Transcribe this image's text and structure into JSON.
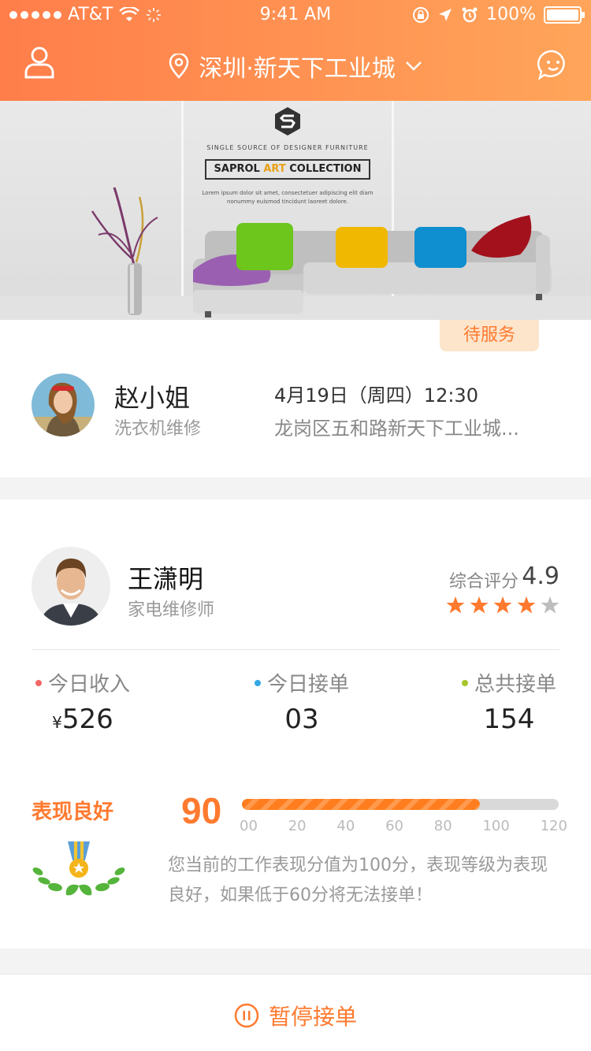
{
  "status_bar": {
    "carrier": "AT&T",
    "time": "9:41 AM",
    "battery": "100%"
  },
  "header": {
    "location": "深圳·新天下工业城",
    "icons": [
      "user-icon",
      "location-pin-icon",
      "chevron-down-icon",
      "chat-icon"
    ]
  },
  "banner": {
    "tagline": "SINGLE SOURCE OF DESIGNER FURNITURE",
    "collection_part1": "SAPROL ",
    "collection_part2": "ART",
    "collection_part3": " COLLECTION",
    "lorem": "Lorem ipsum dolor sit amet, consectetuer adipiscing elit diam nonummy euismod tincidunt laoreet dolore."
  },
  "order": {
    "status": "待服务",
    "customer_name": "赵小姐",
    "service": "洗衣机维修",
    "time": "4月19日（周四）12:30",
    "address": "龙岗区五和路新天下工业城..."
  },
  "technician": {
    "name": "王潇明",
    "role": "家电维修师",
    "rating_label": "综合评分",
    "rating_value": "4.9",
    "stars_filled": 4,
    "stars_total": 5
  },
  "stats": [
    {
      "label": "今日收入",
      "currency": "¥",
      "value": "526",
      "color": "#f06767"
    },
    {
      "label": "今日接单",
      "value": "03",
      "color": "#33a8e6"
    },
    {
      "label": "总共接单",
      "value": "154",
      "color": "#a7c62b"
    }
  ],
  "performance": {
    "title": "表现良好",
    "score": "90",
    "bar_max": 120,
    "ticks": [
      "00",
      "20",
      "40",
      "60",
      "80",
      "100",
      "120"
    ],
    "note": "您当前的工作表现分值为100分，表现等级为表现良好，如果低于60分将无法接单！"
  },
  "bottom": {
    "pause_label": "暂停接单"
  },
  "colors": {
    "accent": "#ff7a2f",
    "header_start": "#ff7e4a",
    "header_end": "#ffa55a"
  }
}
